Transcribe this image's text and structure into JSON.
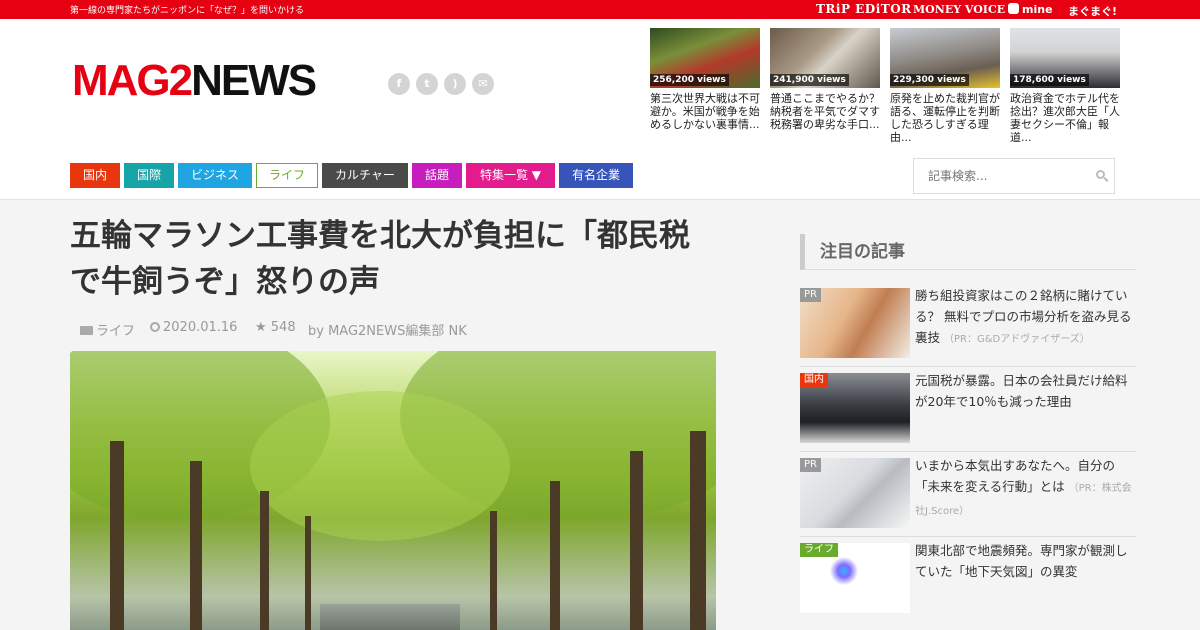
{
  "topbar": {
    "tagline": "第一線の専門家たちがニッポンに「なぜ？」を問いかける",
    "partners": [
      "TRiP EDiTOR",
      "MONEY VOICE",
      "mine",
      "まぐまぐ!"
    ]
  },
  "header": {
    "logo_red": "MAG2",
    "logo_black": "NEWS",
    "social_icons": [
      "facebook-icon",
      "twitter-icon",
      "rss-icon",
      "mail-icon"
    ]
  },
  "trending": [
    {
      "views": "256,200 views",
      "title": "第三次世界大戦は不可避か。米国が戦争を始めるしかない裏事情..."
    },
    {
      "views": "241,900 views",
      "title": "普通ここまでやるか？納税者を平気でダマす税務署の卑劣な手口..."
    },
    {
      "views": "229,300 views",
      "title": "原発を止めた裁判官が語る、運転停止を判断した恐ろしすぎる理由..."
    },
    {
      "views": "178,600 views",
      "title": "政治資金でホテル代を捻出？進次郎大臣「人妻セクシー不倫」報道..."
    }
  ],
  "nav": [
    "国内",
    "国際",
    "ビジネス",
    "ライフ",
    "カルチャー",
    "話題",
    "特集一覧 ▼",
    "有名企業"
  ],
  "search": {
    "placeholder": "記事検索..."
  },
  "article": {
    "headline": "五輪マラソン工事費を北大が負担に「都民税で牛飼うぞ」怒りの声",
    "category": "ライフ",
    "date": "2020.01.16",
    "stars": "★ 548",
    "author": "by MAG2NEWS編集部 NK"
  },
  "sidebar": {
    "heading": "注目の記事",
    "items": [
      {
        "tag": "PR",
        "title": "勝ち組投資家はこの２銘柄に賭けている？ 無料でプロの市場分析を盗み見る裏技",
        "sponsor": "（PR：G&Dアドヴァイザーズ）"
      },
      {
        "tag": "国内",
        "title": "元国税が暴露。日本の会社員だけ給料が20年で10％も減った理由",
        "sponsor": ""
      },
      {
        "tag": "PR",
        "title": "いまから本気出すあなたへ。自分の「未来を変える行動」とは",
        "sponsor": "（PR：株式会社J.Score）"
      },
      {
        "tag": "ライフ",
        "title": "関東北部で地震頻発。専門家が観測していた「地下天気図」の異変",
        "sponsor": ""
      }
    ]
  }
}
